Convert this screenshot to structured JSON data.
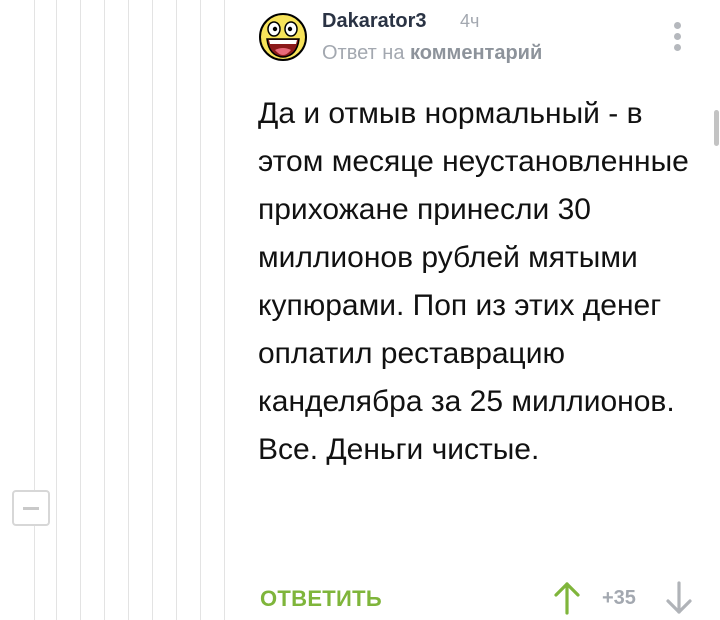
{
  "comment": {
    "author": "Dakarator3",
    "time": "4ч",
    "reply_prefix": "Ответ на",
    "reply_target": "комментарий",
    "text": "Да и отмыв нормальный - в этом месяце неустановленные прихожане принесли 30 миллионов рублей мятыми купюрами. Поп из этих денег оплатил реставрацию канделябра за 25 миллионов. Все. Деньги чистые.",
    "reply_label": "ОТВЕТИТЬ",
    "score": "+35"
  },
  "icons": {
    "avatar": "awesome-face-avatar",
    "menu": "kebab-menu-icon",
    "collapse": "minus-icon",
    "upvote": "arrow-up-icon",
    "downvote": "arrow-down-icon"
  },
  "colors": {
    "accent_green": "#7fb53b",
    "muted_gray": "#a3a8b0",
    "author": "#2a3344",
    "avatar_yellow": "#f7e35a"
  }
}
